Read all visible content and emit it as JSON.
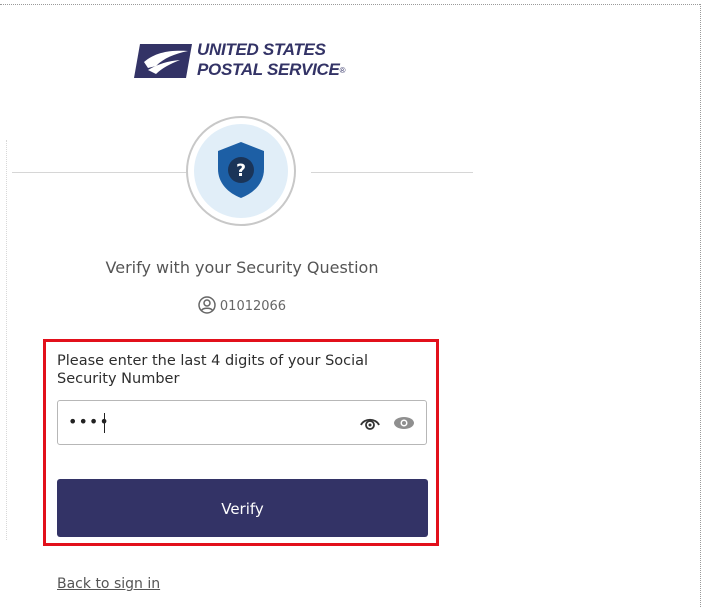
{
  "brand": {
    "line1": "UNITED STATES",
    "line2": "POSTAL SERVICE",
    "registered_mark": "®",
    "color": "#333366"
  },
  "badge": {
    "icon": "shield-question-icon",
    "glyph": "?",
    "shield_color": "#1d5fa5"
  },
  "page": {
    "title": "Verify with your Security Question",
    "username": "01012066"
  },
  "form": {
    "label": "Please enter the last 4 digits of your Social Security Number",
    "masked_value": "••••",
    "toggle_icons": [
      "eye-outline-icon",
      "eye-filled-icon"
    ],
    "submit_label": "Verify",
    "submit_color": "#333366",
    "highlight_color": "#e2101b"
  },
  "footer": {
    "back_link": "Back to sign in"
  }
}
